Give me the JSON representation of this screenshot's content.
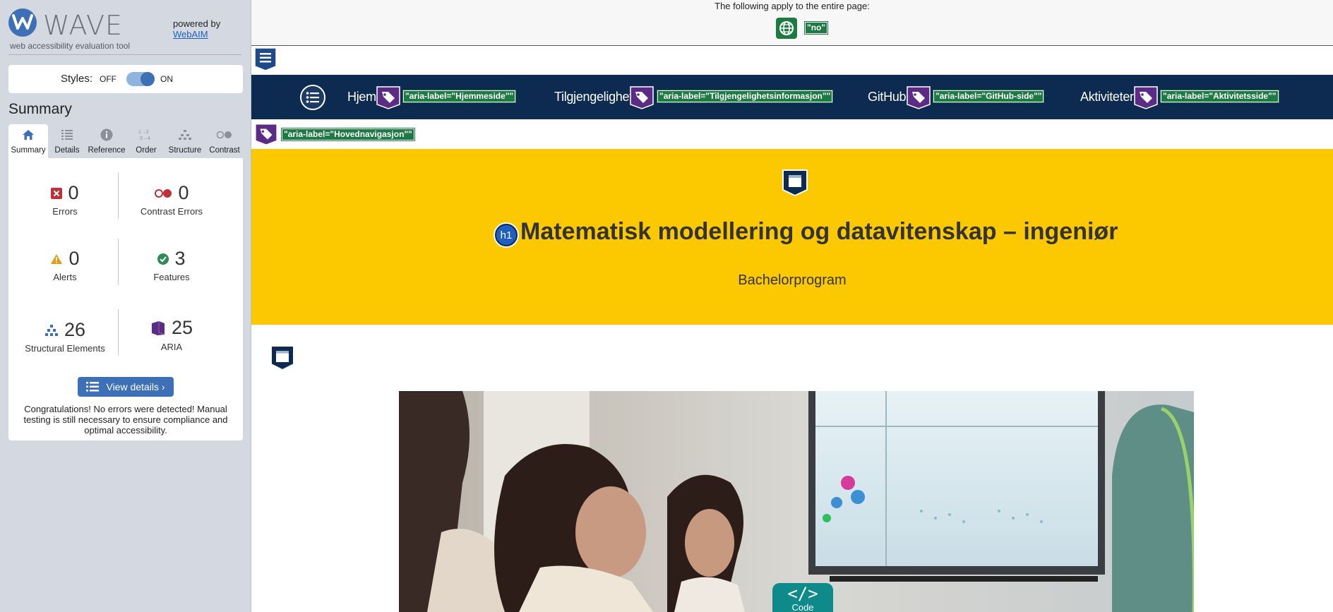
{
  "wave": {
    "logo_text": "WAVE",
    "tagline": "web accessibility evaluation tool",
    "powered_by": "powered by",
    "webaim_link": "WebAIM",
    "styles_label": "Styles:",
    "styles_off": "OFF",
    "styles_on": "ON",
    "styles_toggle_state": "on",
    "summary_heading": "Summary",
    "tabs": [
      {
        "label": "Summary",
        "icon": "home-icon",
        "active": true
      },
      {
        "label": "Details",
        "icon": "list-icon"
      },
      {
        "label": "Reference",
        "icon": "info-icon"
      },
      {
        "label": "Order",
        "icon": "order-icon"
      },
      {
        "label": "Structure",
        "icon": "structure-icon"
      },
      {
        "label": "Contrast",
        "icon": "contrast-icon"
      }
    ],
    "stats": {
      "errors": {
        "value": "0",
        "label": "Errors"
      },
      "contrast_errors": {
        "value": "0",
        "label": "Contrast Errors"
      },
      "alerts": {
        "value": "0",
        "label": "Alerts"
      },
      "features": {
        "value": "3",
        "label": "Features"
      },
      "structural": {
        "value": "26",
        "label": "Structural Elements"
      },
      "aria": {
        "value": "25",
        "label": "ARIA"
      }
    },
    "view_details": "View details ›",
    "congrats": "Congratulations! No errors were detected! Manual testing is still necessary to ensure compliance and optimal accessibility.",
    "colors": {
      "accent": "#3e70b7",
      "error": "#c0303a",
      "alert": "#e69a1a",
      "feature": "#2e8a56",
      "aria": "#5b2b85"
    }
  },
  "page": {
    "applies_text": "The following apply to the entire page:",
    "lang_tag": "\"no\"",
    "nav": [
      {
        "label": "Hjem",
        "aria": "\"aria-label=\"Hjemmeside\"\""
      },
      {
        "label": "Tilgjengelighet",
        "aria": "\"aria-label=\"Tilgjengelighetsinformasjon\"\""
      },
      {
        "label": "GitHub",
        "aria": "\"aria-label=\"GitHub-side\"\""
      },
      {
        "label": "Aktiviteter",
        "aria": "\"aria-label=\"Aktivitetsside\"\""
      }
    ],
    "nav_aria": "\"aria-label=\"Hovednavigasjon\"\"",
    "h1_badge": "h1",
    "title": "Matematisk modellering og datavitenskap – ingeniør",
    "subtitle": "Bachelorprogram",
    "code_badge_symbol": "</>",
    "code_badge_label": "Code",
    "colors": {
      "navbar": "#0d2a50",
      "hero": "#fcc800",
      "wave_tag": "#1e7a43"
    }
  }
}
